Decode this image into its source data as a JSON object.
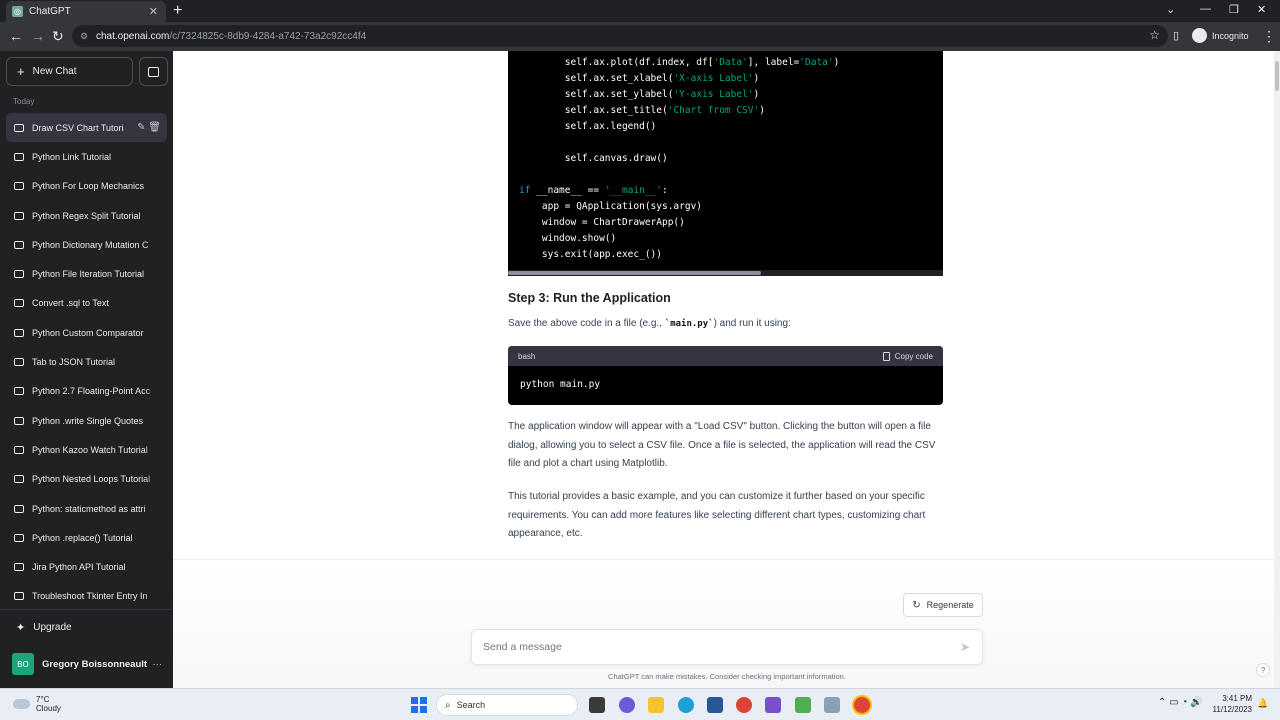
{
  "browser": {
    "tab_title": "ChatGPT",
    "new_tab": "+",
    "url_host": "chat.openai.com",
    "url_path": "/c/7324825c-8db9-4284-a742-73a2c92cc4f4",
    "incognito_label": "Incognito"
  },
  "sidebar": {
    "new_chat": "New Chat",
    "section": "Today",
    "items": [
      {
        "label": "Draw CSV Chart Tutorial"
      },
      {
        "label": "Python Link Tutorial"
      },
      {
        "label": "Python For Loop Mechanics"
      },
      {
        "label": "Python Regex Split Tutorial"
      },
      {
        "label": "Python Dictionary Mutation C"
      },
      {
        "label": "Python File Iteration Tutorial"
      },
      {
        "label": "Convert .sql to Text"
      },
      {
        "label": "Python Custom Comparator"
      },
      {
        "label": "Tab to JSON Tutorial"
      },
      {
        "label": "Python 2.7 Floating-Point Acc"
      },
      {
        "label": "Python .write Single Quotes"
      },
      {
        "label": "Python Kazoo Watch Tutorial"
      },
      {
        "label": "Python Nested Loops Tutorial"
      },
      {
        "label": "Python: staticmethod as attri"
      },
      {
        "label": "Python .replace() Tutorial"
      },
      {
        "label": "Jira Python API Tutorial"
      },
      {
        "label": "Troubleshoot Tkinter Entry In"
      }
    ],
    "upgrade": "Upgrade",
    "user_initials": "BO",
    "user_name": "Gregory Boissonneault",
    "user_menu": "···"
  },
  "content": {
    "code_lines": {
      "l1a": "        self.ax.plot(df.index, df[",
      "l1s1": "'Data'",
      "l1b": "], label=",
      "l1s2": "'Data'",
      "l1c": ")",
      "l2a": "        self.ax.set_xlabel(",
      "l2s": "'X-axis Label'",
      "l2b": ")",
      "l3a": "        self.ax.set_ylabel(",
      "l3s": "'Y-axis Label'",
      "l3b": ")",
      "l4a": "        self.ax.set_title(",
      "l4s": "'Chart from CSV'",
      "l4b": ")",
      "l5": "        self.ax.legend()",
      "l6": "        self.canvas.draw()",
      "l7kw": "if",
      "l7a": " __name__ == ",
      "l7s": "'__main__'",
      "l7b": ":",
      "l8": "    app = QApplication(sys.argv)",
      "l9": "    window = ChartDrawerApp()",
      "l10": "    window.show()",
      "l11": "    sys.exit(app.exec_())"
    },
    "step_heading": "Step 3: Run the Application",
    "save_text_a": "Save the above code in a file (e.g., ",
    "save_code": "`main.py`",
    "save_text_b": ") and run it using:",
    "code2_lang": "bash",
    "copy_code": "Copy code",
    "code2_text": "python main.py",
    "para1": "The application window will appear with a \"Load CSV\" button. Clicking the button will open a file dialog, allowing you to select a CSV file. Once a file is selected, the application will read the CSV file and plot a chart using Matplotlib.",
    "para2": "This tutorial provides a basic example, and you can customize it further based on your specific requirements. You can add more features like selecting different chart types, customizing chart appearance, etc.",
    "regenerate": "Regenerate",
    "composer_placeholder": "Send a message",
    "disclaimer": "ChatGPT can make mistakes. Consider checking important information.",
    "help": "?"
  },
  "taskbar": {
    "temp": "7°C",
    "weather": "Cloudy",
    "search": "Search",
    "time": "3:41 PM",
    "date": "11/12/2023"
  },
  "colors": {
    "sidebar_bg": "#202123",
    "code_string": "#00a67d",
    "code_keyword": "#2e95d3"
  }
}
